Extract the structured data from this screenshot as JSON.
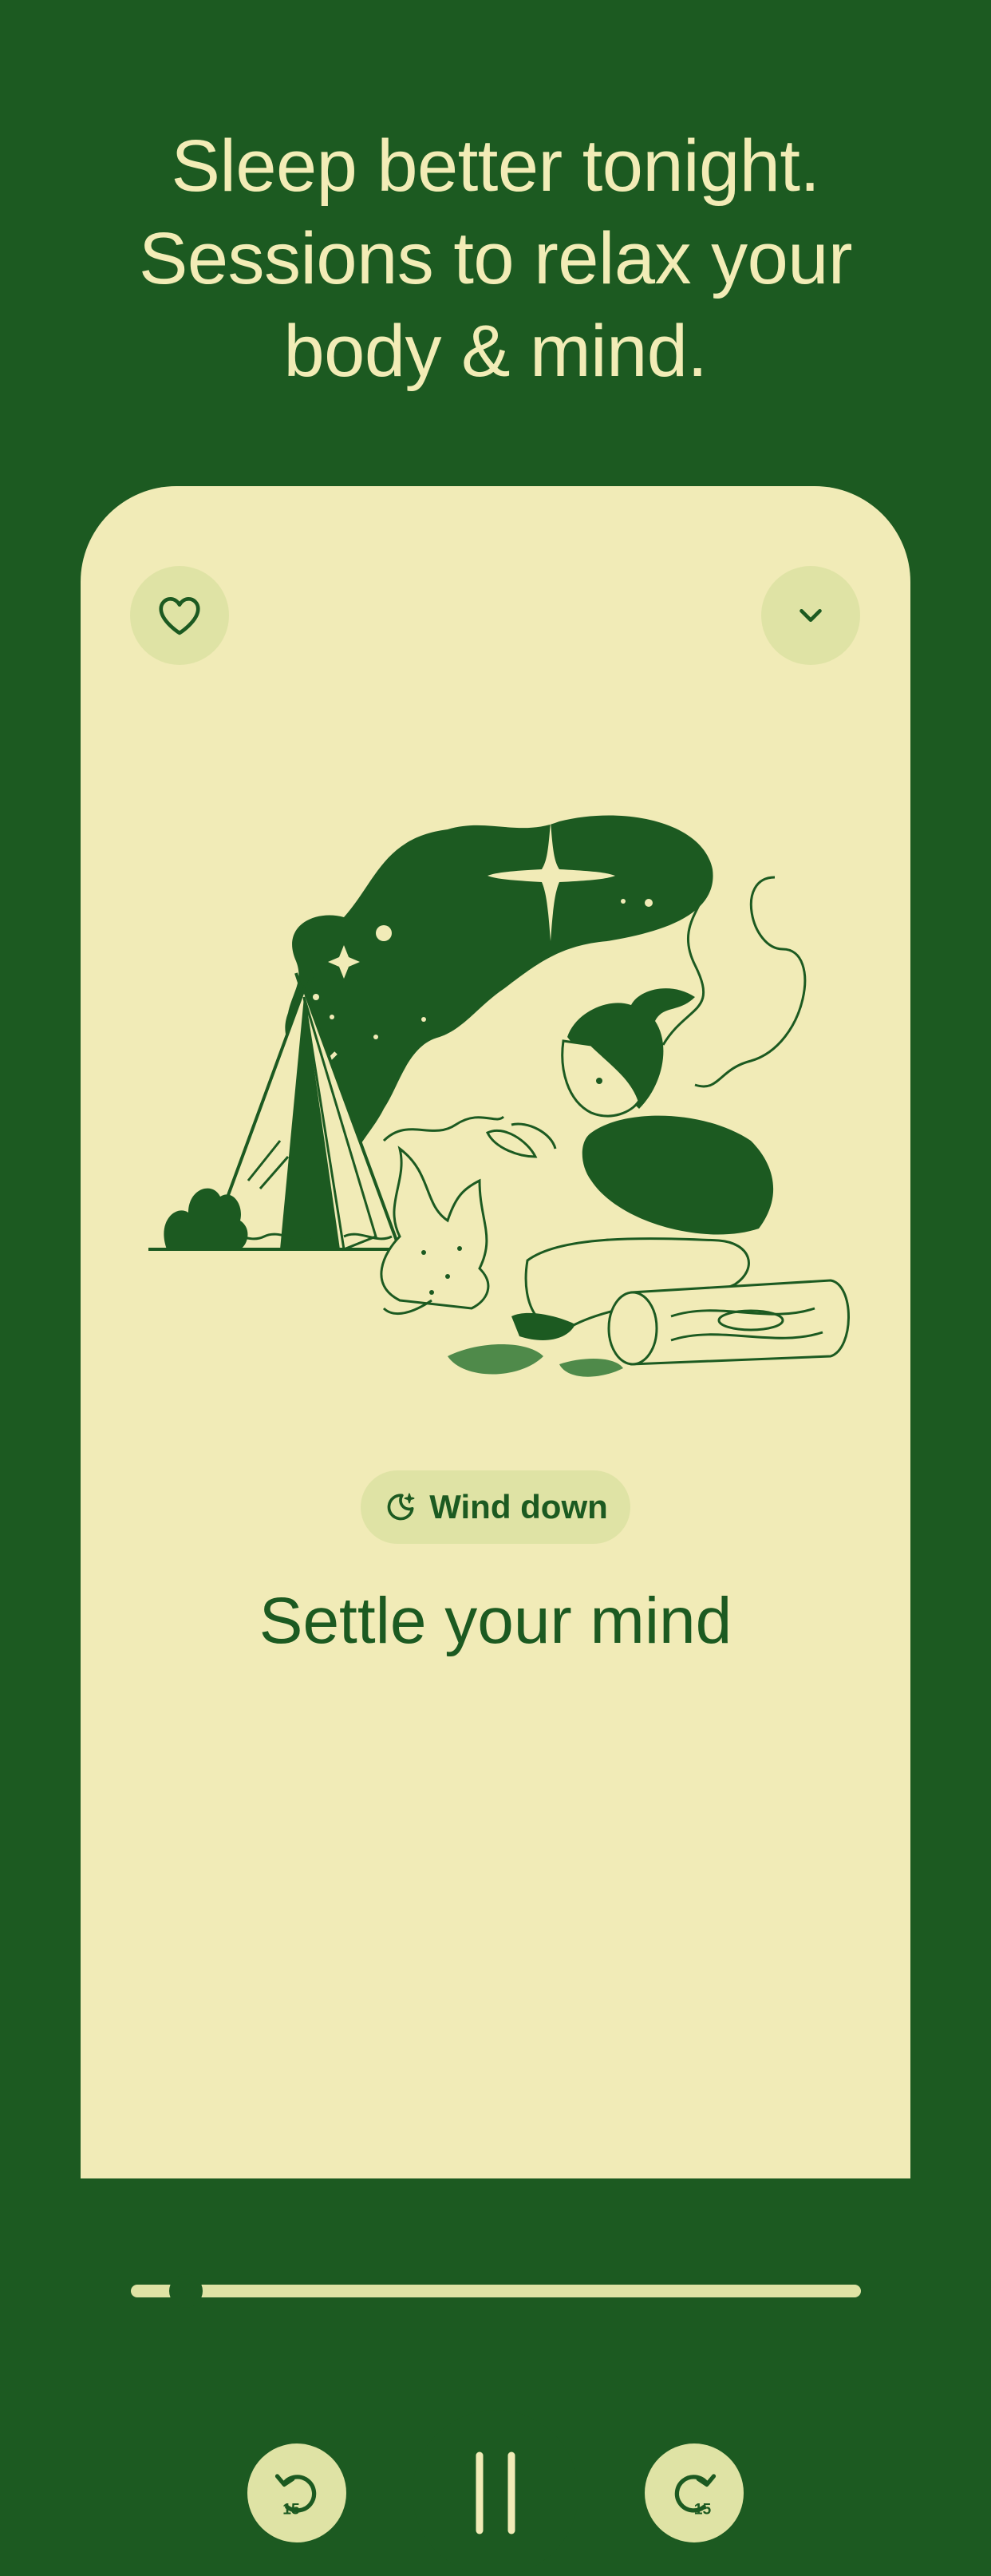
{
  "headline": {
    "lines": [
      "Sleep better tonight.",
      "Sessions to relax your",
      "body & mind."
    ]
  },
  "player": {
    "favorite_icon": "heart-icon",
    "collapse_icon": "chevron-down-icon",
    "category": {
      "icon": "moon-sparkle-icon",
      "label": "Wind down"
    },
    "title": "Settle your mind",
    "progress": 0.075,
    "controls": {
      "rewind": {
        "icon": "rewind-15-icon",
        "label": "15"
      },
      "play_pause": {
        "icon": "pause-icon",
        "state": "playing"
      },
      "forward": {
        "icon": "forward-15-icon",
        "label": "15"
      }
    }
  },
  "colors": {
    "background": "#1c5a21",
    "card": "#f1ebb7",
    "accent_soft": "#dfe3a5",
    "text_light": "#f2ecb6"
  }
}
